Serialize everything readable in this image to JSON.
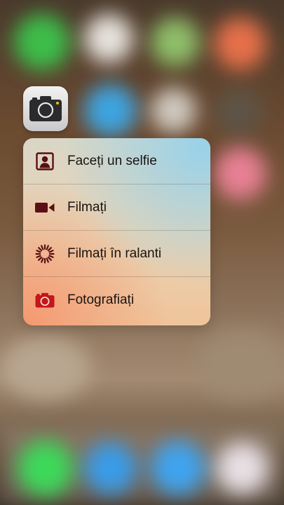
{
  "app": {
    "name": "Camera",
    "icon": "camera-app-icon"
  },
  "quick_actions": {
    "items": [
      {
        "label": "Faceți un selfie",
        "icon": "selfie-portrait-icon"
      },
      {
        "label": "Filmați",
        "icon": "video-camera-icon"
      },
      {
        "label": "Filmați în ralanti",
        "icon": "slow-motion-icon"
      },
      {
        "label": "Fotografiați",
        "icon": "camera-icon"
      }
    ]
  },
  "colors": {
    "icon_dark": "#5a0f14",
    "icon_red": "#c4161c",
    "text": "#1a1410"
  }
}
